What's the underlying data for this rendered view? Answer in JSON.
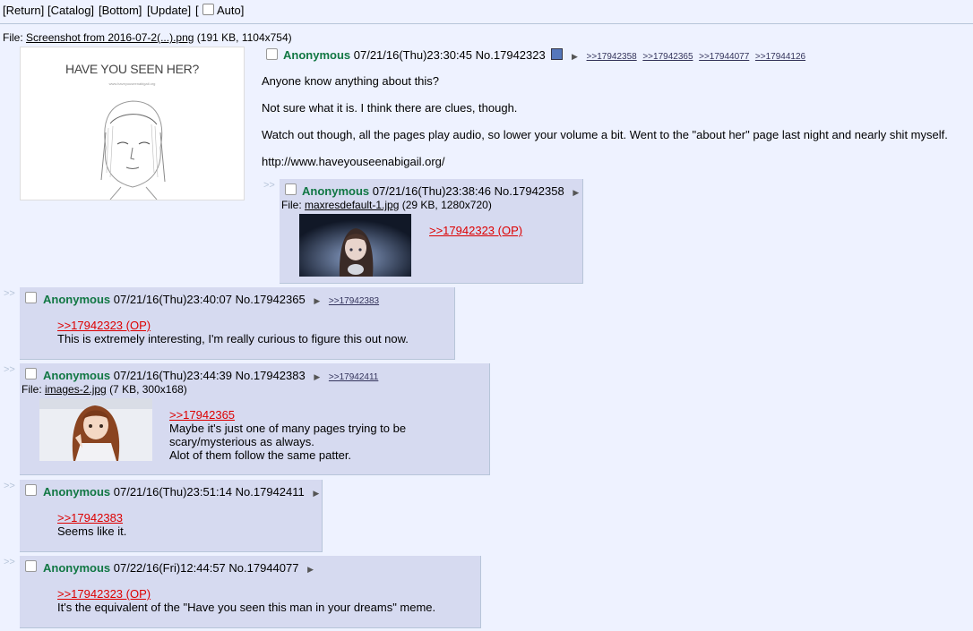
{
  "topbar": {
    "return": "[Return]",
    "catalog": "[Catalog]",
    "bottom": "[Bottom]",
    "update": "[Update]",
    "auto_open": "[",
    "auto": "Auto]"
  },
  "op": {
    "file_label": "File:",
    "file_name": "Screenshot from 2016-07-2(...).png",
    "file_info": "(191 KB, 1104x754)",
    "image_heading": "HAVE YOU SEEN HER?",
    "image_subtext": "www.haveyouseenabigail.org",
    "name": "Anonymous",
    "datetime": "07/21/16(Thu)23:30:45",
    "number": "No.17942323",
    "replies": [
      ">>17942358",
      ">>17942365",
      ">>17944077",
      ">>17944126"
    ],
    "lines": [
      "Anyone know anything about this?",
      "Not sure what it is. I think there are clues, though.",
      "Watch out though, all the pages play audio, so lower your volume a bit. Went to the \"about her\" page last night and nearly shit myself.",
      "http://www.haveyouseenabigail.org/"
    ]
  },
  "posts": [
    {
      "name": "Anonymous",
      "datetime": "07/21/16(Thu)23:38:46",
      "number": "No.17942358",
      "file_label": "File:",
      "file_name": "maxresdefault-1.jpg",
      "file_info": "(29 KB, 1280x720)",
      "quote": ">>17942323 (OP)",
      "lines": []
    },
    {
      "name": "Anonymous",
      "datetime": "07/21/16(Thu)23:40:07",
      "number": "No.17942365",
      "reply": ">>17942383",
      "quote": ">>17942323 (OP)",
      "lines": [
        "This is extremely interesting, I'm really curious to figure this out now."
      ]
    },
    {
      "name": "Anonymous",
      "datetime": "07/21/16(Thu)23:44:39",
      "number": "No.17942383",
      "reply": ">>17942411",
      "file_label": "File:",
      "file_name": "images-2.jpg",
      "file_info": "(7 KB, 300x168)",
      "quote": ">>17942365",
      "lines": [
        "Maybe it's just one of many pages trying to be",
        "scary/mysterious as always.",
        "Alot of them follow the same patter."
      ]
    },
    {
      "name": "Anonymous",
      "datetime": "07/21/16(Thu)23:51:14",
      "number": "No.17942411",
      "quote": ">>17942383",
      "lines": [
        "Seems like it."
      ]
    },
    {
      "name": "Anonymous",
      "datetime": "07/22/16(Fri)12:44:57",
      "number": "No.17944077",
      "quote": ">>17942323 (OP)",
      "lines": [
        "It's the equivalent of the \"Have you seen this man in your dreams\" meme."
      ]
    }
  ],
  "colors": {
    "background": "#eef2ff",
    "post": "#d6daf0",
    "name": "#117743",
    "quote": "#dd0000"
  }
}
